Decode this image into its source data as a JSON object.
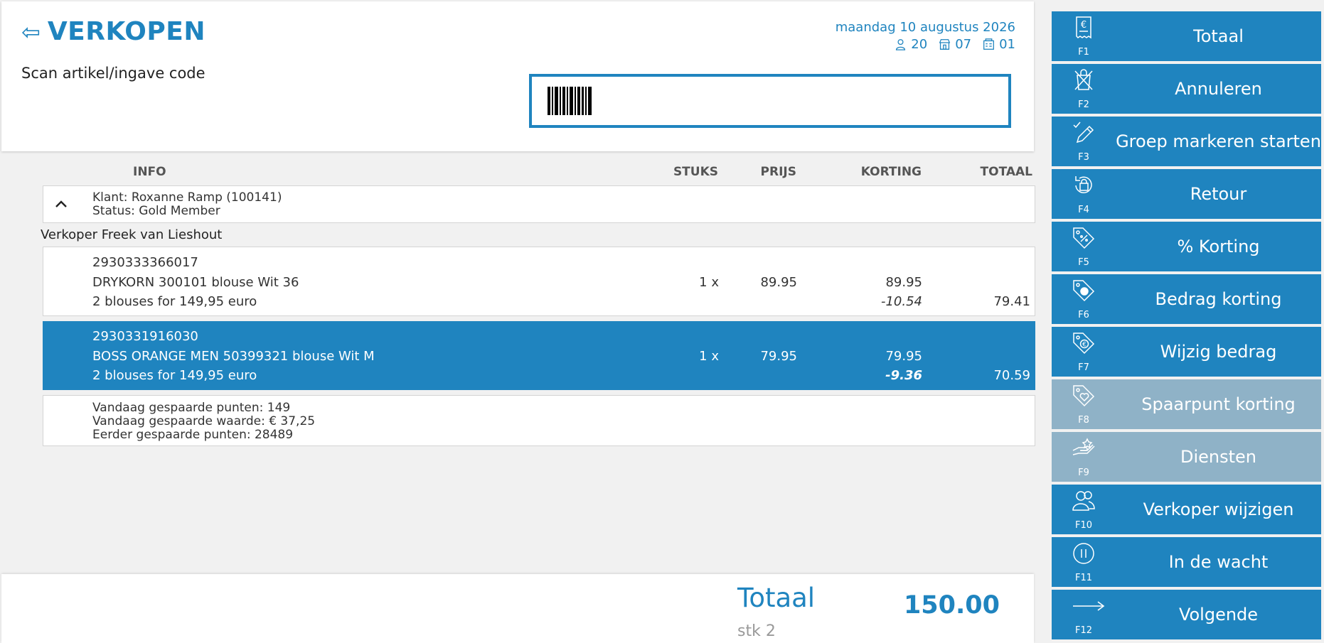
{
  "header": {
    "title": "VERKOPEN",
    "scan_label": "Scan artikel/ingave code",
    "date": "maandag 10 augustus 2026",
    "user_code": "20",
    "store_code": "07",
    "register_code": "01",
    "scan_value": ""
  },
  "columns": {
    "info": "INFO",
    "stuks": "STUKS",
    "prijs": "PRIJS",
    "korting": "KORTING",
    "totaal": "TOTAAL"
  },
  "customer": {
    "name": "Klant: Roxanne Ramp (100141)",
    "status": "Status: Gold Member"
  },
  "seller": "Verkoper Freek van Lieshout",
  "items": [
    {
      "code": "2930333366017",
      "description": "DRYKORN 300101 blouse Wit 36",
      "promo": "2 blouses for 149,95 euro",
      "qty": "1 x",
      "price": "89.95",
      "discount_base": "89.95",
      "discount": "-10.54",
      "total": "79.41"
    },
    {
      "code": "2930331916030",
      "description": "BOSS ORANGE MEN 50399321 blouse Wit M",
      "promo": "2 blouses for 149,95 euro",
      "qty": "1 x",
      "price": "79.95",
      "discount_base": "79.95",
      "discount": "-9.36",
      "total": "70.59"
    }
  ],
  "points": {
    "today_points": "Vandaag gespaarde punten: 149",
    "today_value": "Vandaag gespaarde waarde: € 37,25",
    "earlier_points": "Eerder gespaarde punten: 28489"
  },
  "footer": {
    "total_label": "Totaal",
    "total_value": "150.00",
    "count": "stk 2"
  },
  "fkeys": [
    {
      "code": "F1",
      "label": "Totaal",
      "icon": "receipt-euro-icon",
      "enabled": true
    },
    {
      "code": "F2",
      "label": "Annuleren",
      "icon": "cancel-bag-icon",
      "enabled": true
    },
    {
      "code": "F3",
      "label": "Groep markeren starten",
      "icon": "pencil-check-icon",
      "enabled": true
    },
    {
      "code": "F4",
      "label": "Retour",
      "icon": "return-bag-icon",
      "enabled": true
    },
    {
      "code": "F5",
      "label": "% Korting",
      "icon": "tag-percent-icon",
      "enabled": true
    },
    {
      "code": "F6",
      "label": "Bedrag korting",
      "icon": "tag-coin-icon",
      "enabled": true
    },
    {
      "code": "F7",
      "label": "Wijzig bedrag",
      "icon": "tag-euro-icon",
      "enabled": true
    },
    {
      "code": "F8",
      "label": "Spaarpunt korting",
      "icon": "tag-heart-icon",
      "enabled": false
    },
    {
      "code": "F9",
      "label": "Diensten",
      "icon": "hand-service-icon",
      "enabled": false
    },
    {
      "code": "F10",
      "label": "Verkoper wijzigen",
      "icon": "users-icon",
      "enabled": true
    },
    {
      "code": "F11",
      "label": "In de wacht",
      "icon": "pause-icon",
      "enabled": true
    },
    {
      "code": "F12",
      "label": "Volgende",
      "icon": "arrow-right-icon",
      "enabled": true
    }
  ],
  "colors": {
    "accent": "#1f84bf",
    "disabled": "#8fb2c7",
    "background": "#f1f1f1"
  }
}
